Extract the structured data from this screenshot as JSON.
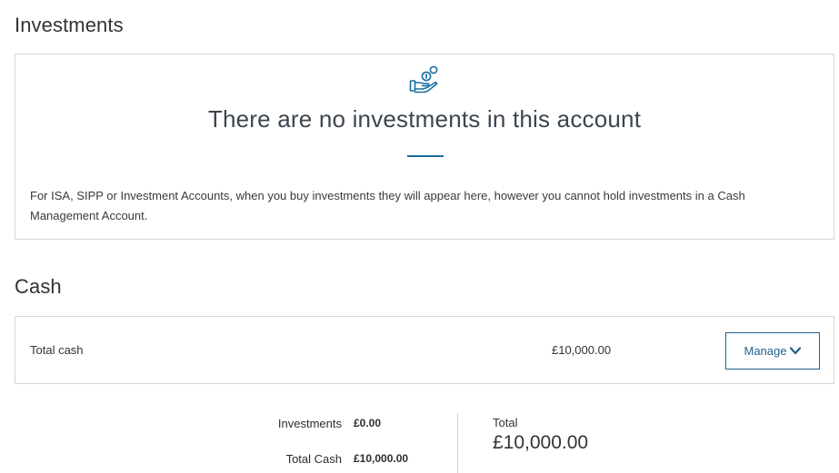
{
  "investments": {
    "title": "Investments",
    "empty_state": {
      "icon": "hand-coins-icon",
      "heading": "There are no investments in this account",
      "description": "For ISA, SIPP or Investment Accounts, when you buy investments they will appear here, however you cannot hold investments in a Cash Management Account."
    }
  },
  "cash": {
    "title": "Cash",
    "row": {
      "label": "Total cash",
      "amount": "£10,000.00",
      "manage_label": "Manage"
    }
  },
  "summary": {
    "investments_label": "Investments",
    "investments_value": "£0.00",
    "total_cash_label": "Total Cash",
    "total_cash_value": "£10,000.00",
    "total_label": "Total",
    "total_value": "£10,000.00"
  },
  "colors": {
    "accent": "#1f5f8b",
    "rule": "#1a6fa0",
    "border": "#d8d8d8"
  }
}
